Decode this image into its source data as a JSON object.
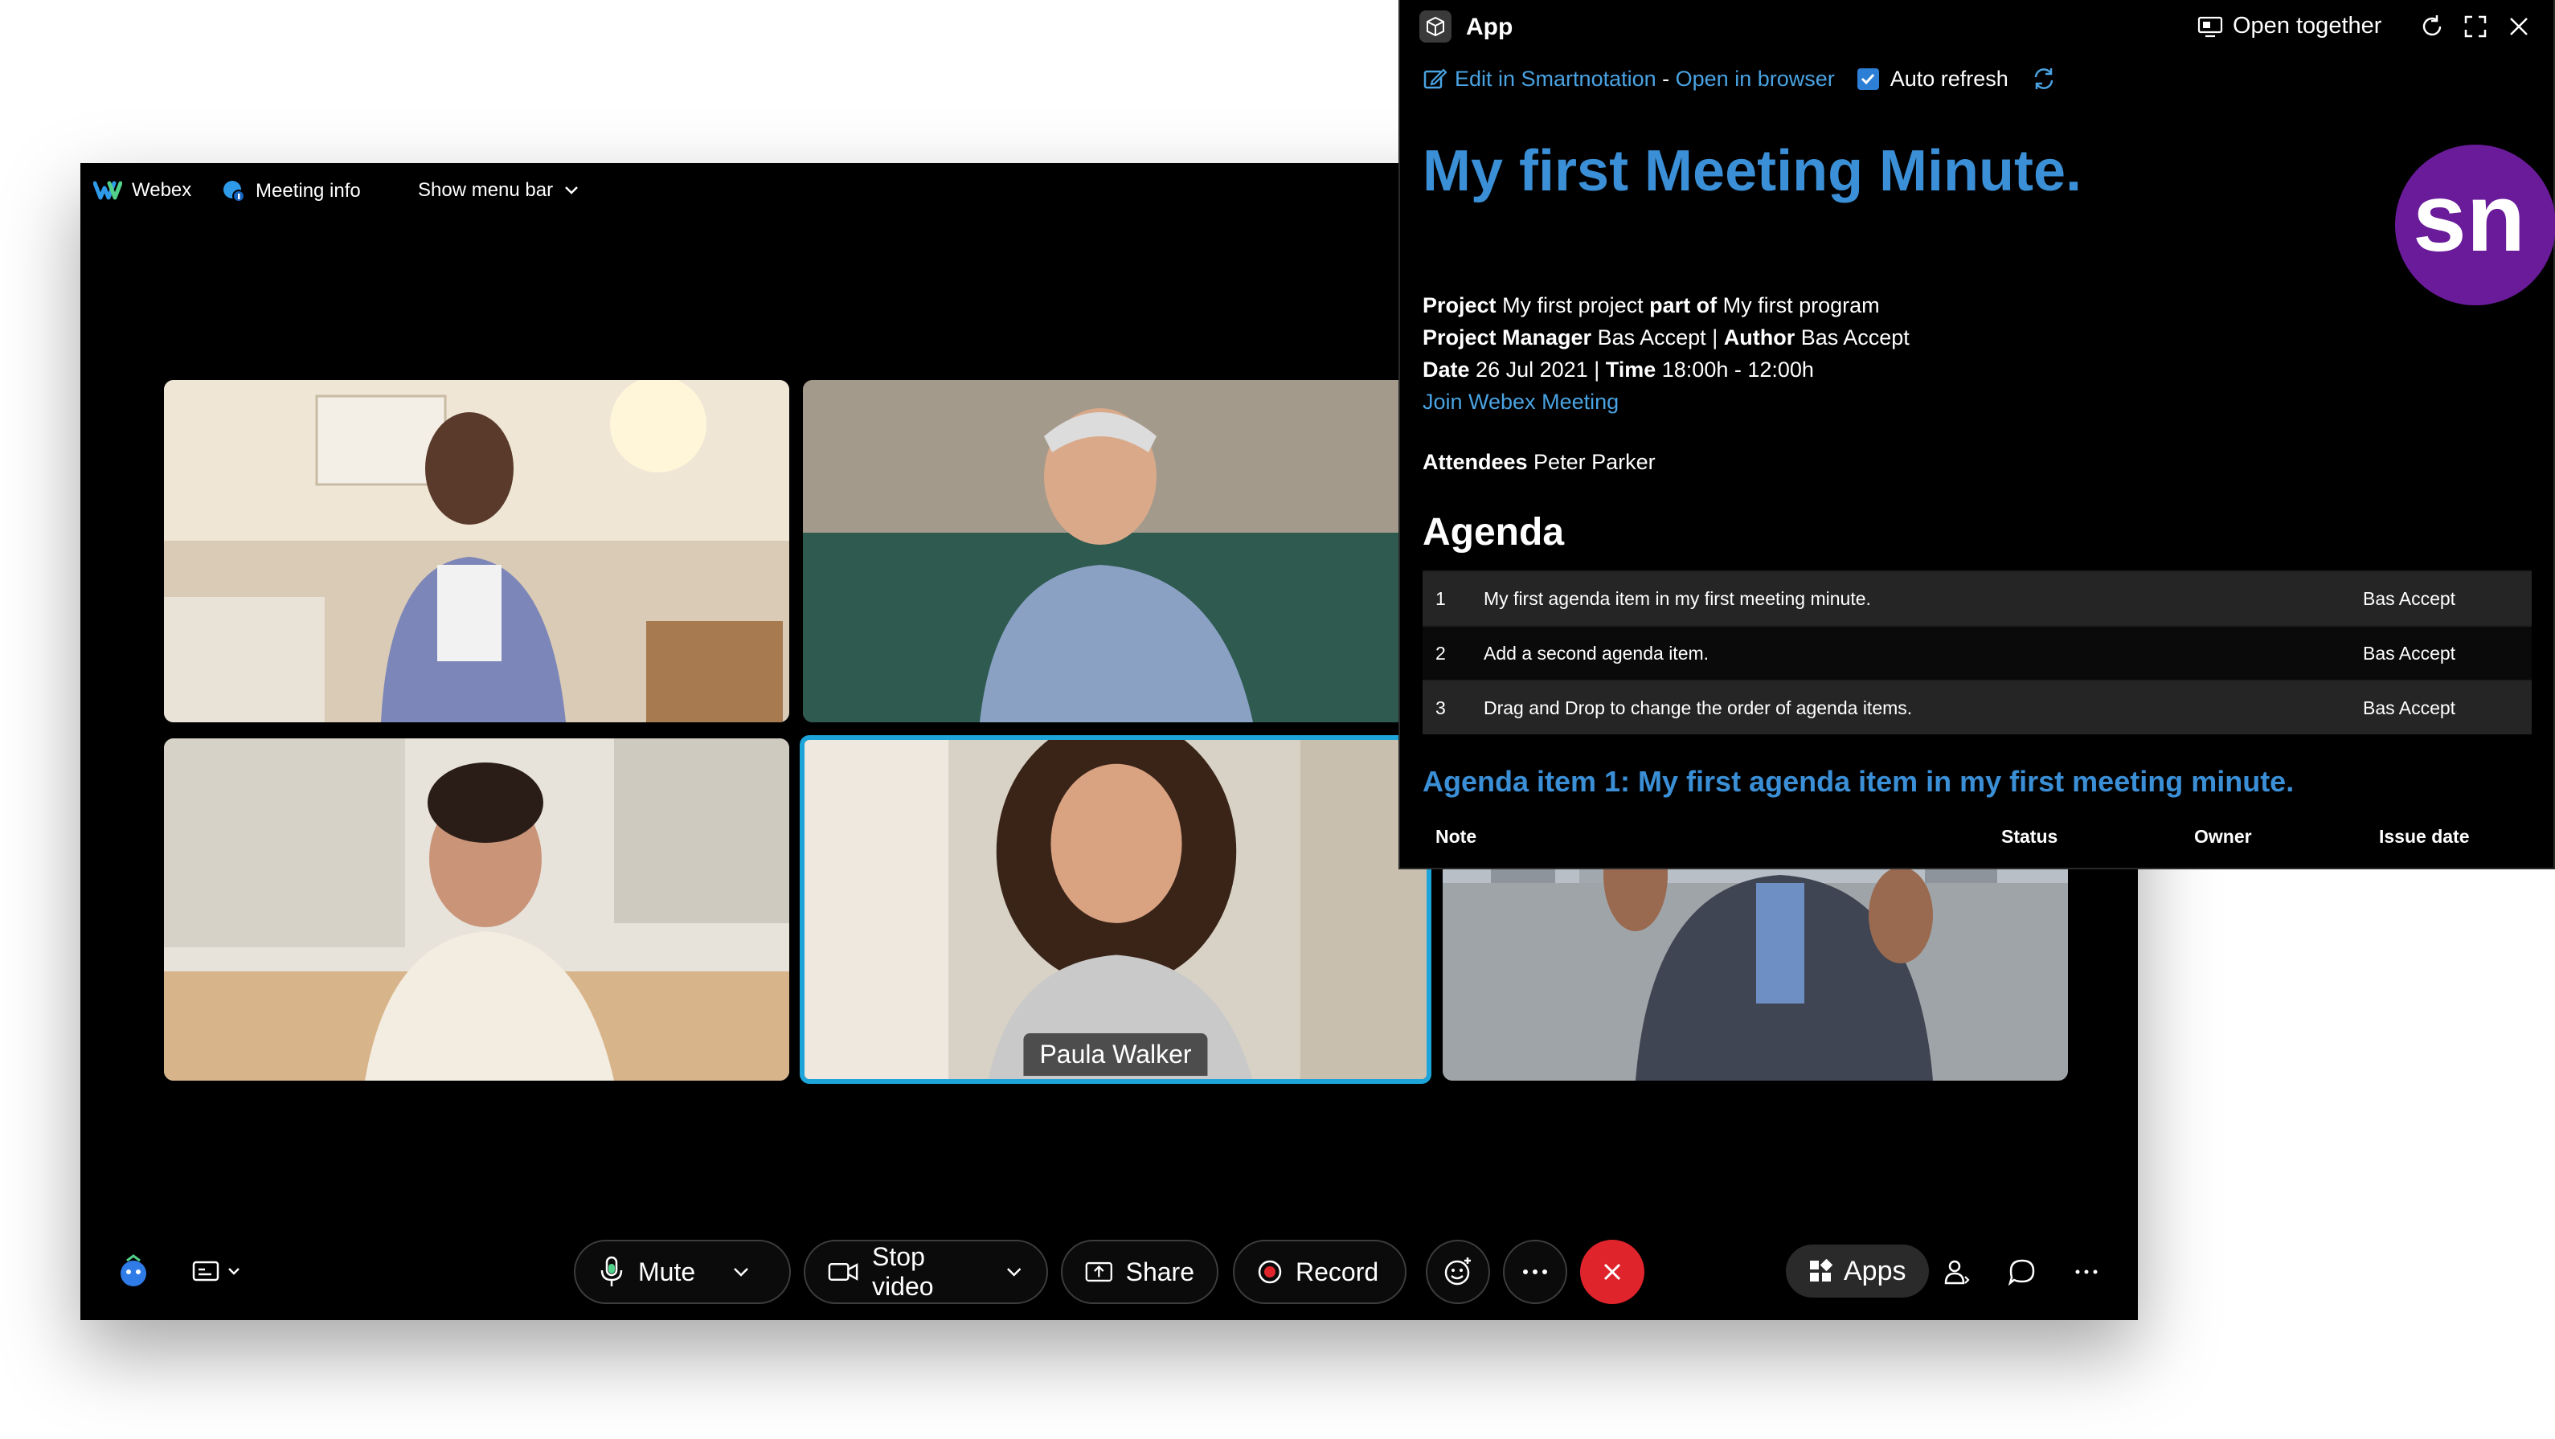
{
  "webex": {
    "brand": "Webex",
    "meeting_info": "Meeting info",
    "show_menu_bar": "Show menu bar",
    "participant_name": "Paula Walker",
    "controls": {
      "mute": "Mute",
      "stop_video": "Stop video",
      "share": "Share",
      "record": "Record",
      "apps": "Apps"
    },
    "colors": {
      "active_border": "#1da4d8",
      "end_call": "#e0242c",
      "record_dot": "#e0242c"
    }
  },
  "panel": {
    "title": "App",
    "open_together": "Open together",
    "edit_link": "Edit in Smartnotation",
    "separator": " - ",
    "open_browser": "Open in browser",
    "auto_refresh": "Auto refresh",
    "heading": "My first Meeting Minute.",
    "logo_text": "sn",
    "meta": {
      "project_label": "Project",
      "project": "My first project",
      "part_of_label": "part of",
      "program": "My first program",
      "pm_label": "Project Manager",
      "pm": "Bas Accept",
      "author_label": "Author",
      "author": "Bas Accept",
      "date_label": "Date",
      "date": "26 Jul 2021",
      "time_label": "Time",
      "time": "18:00h - 12:00h",
      "join_link": "Join Webex Meeting",
      "divider": "|"
    },
    "attendees_label": "Attendees",
    "attendees": "Peter Parker",
    "agenda_heading": "Agenda",
    "agenda": [
      {
        "num": "1",
        "text": "My first agenda item in my first meeting minute.",
        "owner": "Bas Accept"
      },
      {
        "num": "2",
        "text": "Add a second agenda item.",
        "owner": "Bas Accept"
      },
      {
        "num": "3",
        "text": "Drag and Drop to change the order of agenda items.",
        "owner": "Bas Accept"
      }
    ],
    "item_heading": "Agenda item 1: My first agenda item in my first meeting minute.",
    "notes_columns": {
      "note": "Note",
      "status": "Status",
      "owner": "Owner",
      "issue_date": "Issue date"
    },
    "colors": {
      "accent": "#3a8fd6",
      "link": "#4aa3e2",
      "logo": "#6a1b9a"
    }
  }
}
